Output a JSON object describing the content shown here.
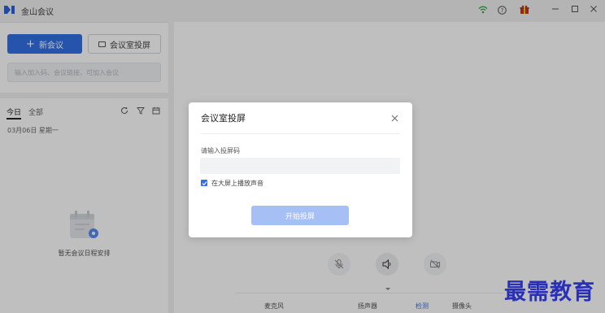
{
  "app": {
    "title": "金山会议"
  },
  "titlebar": {
    "icons": [
      "wifi-icon",
      "help-icon",
      "gift-icon"
    ],
    "window_controls": [
      "minimize",
      "maximize",
      "close"
    ]
  },
  "left_top": {
    "new_meeting_label": "新会议",
    "room_cast_label": "会议室投屏",
    "join_placeholder": "输入加入码、会议链接，可加入会议"
  },
  "schedule": {
    "tab_today": "今日",
    "tab_all": "全部",
    "date": "03月06日 星期一",
    "empty_text": "暂无会议日程安排"
  },
  "device_bar": {
    "mic": "麦克风",
    "speaker": "扬声器",
    "detect": "检测",
    "camera": "摄像头"
  },
  "modal": {
    "title": "会议室投屏",
    "field_label": "请输入投屏码",
    "input_value": "",
    "checkbox_label": "在大屏上播放声音",
    "checkbox_checked": true,
    "start_button": "开始投屏",
    "colors": {
      "primary": "#3370e6",
      "disabled_primary": "#a6bff5"
    }
  },
  "watermark": "最需教育"
}
